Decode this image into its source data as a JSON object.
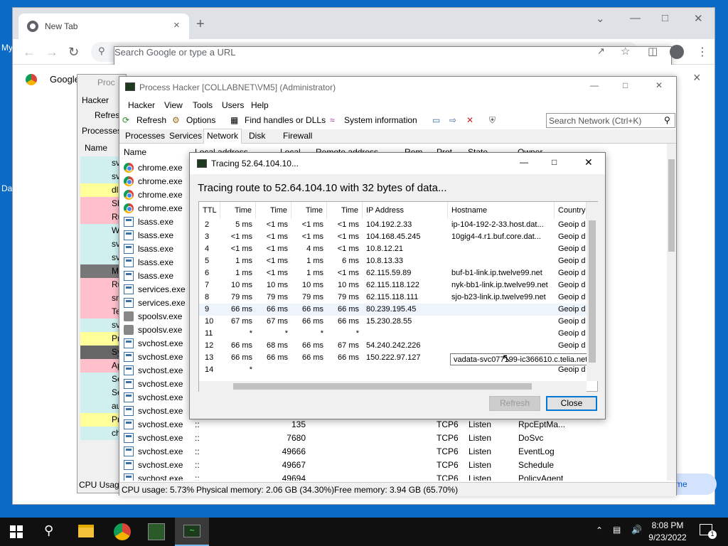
{
  "desktop": {
    "left_label": "My",
    "left_label2": "Da"
  },
  "browser": {
    "tab_title": "New Tab",
    "tab_close": "×",
    "new_tab": "+",
    "omnibox_placeholder": "Search Google or type a URL",
    "bookmark_google": "Google",
    "bookmark_close": "×",
    "corner_text": "me"
  },
  "ph_back": {
    "title": "Proc",
    "menu": "Hacker",
    "refresh": "Refres",
    "processes": "Processes",
    "name": "Name",
    "cpu": "CPU Usage",
    "rows": [
      "sv",
      "sv",
      "dll",
      "Sh",
      "Ru",
      "W",
      "sv",
      "sv",
      "M",
      "Ru",
      "sm",
      "Te",
      "sv",
      "Pr",
      "Sy",
      "Ap",
      "Se",
      "Se",
      "au",
      "Pr",
      "ch"
    ]
  },
  "ph": {
    "title": "Process Hacker [COLLABNET\\VM5] (Administrator)",
    "menu": [
      "Hacker",
      "View",
      "Tools",
      "Users",
      "Help"
    ],
    "toolbar": {
      "refresh": "Refresh",
      "options": "Options",
      "find": "Find handles or DLLs",
      "sysinfo": "System information"
    },
    "search_placeholder": "Search Network (Ctrl+K)",
    "tabs": [
      "Processes",
      "Services",
      "Network",
      "Disk",
      "Firewall"
    ],
    "columns": {
      "name": "Name",
      "local_address": "Local address",
      "local": "Local",
      "remote_address": "Remote address",
      "rem": "Rem",
      "prot": "Prot",
      "state": "State",
      "owner": "Owner"
    },
    "rows": [
      {
        "name": "chrome.exe",
        "icon": "chrome"
      },
      {
        "name": "chrome.exe",
        "icon": "chrome"
      },
      {
        "name": "chrome.exe",
        "icon": "chrome"
      },
      {
        "name": "chrome.exe",
        "icon": "chrome"
      },
      {
        "name": "lsass.exe",
        "icon": "exe"
      },
      {
        "name": "lsass.exe",
        "icon": "exe"
      },
      {
        "name": "lsass.exe",
        "icon": "exe"
      },
      {
        "name": "lsass.exe",
        "icon": "exe"
      },
      {
        "name": "lsass.exe",
        "icon": "exe"
      },
      {
        "name": "services.exe",
        "icon": "exe"
      },
      {
        "name": "services.exe",
        "icon": "exe"
      },
      {
        "name": "spoolsv.exe",
        "icon": "print"
      },
      {
        "name": "spoolsv.exe",
        "icon": "print"
      },
      {
        "name": "svchost.exe",
        "icon": "exe"
      },
      {
        "name": "svchost.exe",
        "icon": "exe"
      },
      {
        "name": "svchost.exe",
        "icon": "exe"
      },
      {
        "name": "svchost.exe",
        "icon": "exe"
      },
      {
        "name": "svchost.exe",
        "icon": "exe"
      },
      {
        "name": "svchost.exe",
        "icon": "exe"
      },
      {
        "name": "svchost.exe",
        "icon": "exe",
        "local": "::",
        "port": "135",
        "prot": "TCP6",
        "state": "Listen",
        "owner": "RpcEptMa..."
      },
      {
        "name": "svchost.exe",
        "icon": "exe",
        "local": "::",
        "port": "7680",
        "prot": "TCP6",
        "state": "Listen",
        "owner": "DoSvc"
      },
      {
        "name": "svchost.exe",
        "icon": "exe",
        "local": "::",
        "port": "49666",
        "prot": "TCP6",
        "state": "Listen",
        "owner": "EventLog"
      },
      {
        "name": "svchost.exe",
        "icon": "exe",
        "local": "::",
        "port": "49667",
        "prot": "TCP6",
        "state": "Listen",
        "owner": "Schedule"
      },
      {
        "name": "svchost.exe",
        "icon": "exe",
        "local": "::",
        "port": "49694",
        "prot": "TCP6",
        "state": "Listen",
        "owner": "PolicyAgent"
      }
    ],
    "status": {
      "cpu": "CPU usage: 5.73%",
      "physical": "Physical memory: 2.06 GB (34.30%)",
      "free": "Free memory: 3.94 GB (65.70%)"
    }
  },
  "dialog": {
    "title": "Tracing 52.64.104.10...",
    "header": "Tracing route to 52.64.104.10 with 32 bytes of data...",
    "columns": [
      "TTL",
      "Time",
      "Time",
      "Time",
      "Time",
      "IP Address",
      "Hostname",
      "Country"
    ],
    "rows": [
      [
        "2",
        "5 ms",
        "<1 ms",
        "<1 ms",
        "<1 ms",
        "104.192.2.33",
        "ip-104-192-2-33.host.dat...",
        "Geoip d"
      ],
      [
        "3",
        "<1 ms",
        "<1 ms",
        "<1 ms",
        "<1 ms",
        "104.168.45.245",
        "10gig4-4.r1.buf.core.dat...",
        "Geoip d"
      ],
      [
        "4",
        "<1 ms",
        "<1 ms",
        "4 ms",
        "<1 ms",
        "10.8.12.21",
        "",
        "Geoip d"
      ],
      [
        "5",
        "1 ms",
        "<1 ms",
        "1 ms",
        "6 ms",
        "10.8.13.33",
        "",
        "Geoip d"
      ],
      [
        "6",
        "1 ms",
        "<1 ms",
        "1 ms",
        "<1 ms",
        "62.115.59.89",
        "buf-b1-link.ip.twelve99.net",
        "Geoip d"
      ],
      [
        "7",
        "10 ms",
        "10 ms",
        "10 ms",
        "10 ms",
        "62.115.118.122",
        "nyk-bb1-link.ip.twelve99.net",
        "Geoip d"
      ],
      [
        "8",
        "79 ms",
        "79 ms",
        "79 ms",
        "79 ms",
        "62.115.118.111",
        "sjo-b23-link.ip.twelve99.net",
        "Geoip d"
      ],
      [
        "9",
        "66 ms",
        "66 ms",
        "66 ms",
        "66 ms",
        "80.239.195.45",
        "",
        "Geoip d"
      ],
      [
        "10",
        "67 ms",
        "67 ms",
        "66 ms",
        "66 ms",
        "15.230.28.55",
        "",
        "Geoip d"
      ],
      [
        "11",
        "*",
        "*",
        "*",
        "*",
        "",
        "",
        "Geoip d"
      ],
      [
        "12",
        "66 ms",
        "68 ms",
        "66 ms",
        "67 ms",
        "54.240.242.226",
        "",
        "Geoip d"
      ],
      [
        "13",
        "66 ms",
        "66 ms",
        "66 ms",
        "66 ms",
        "150.222.97.127",
        "",
        "Geoip d"
      ],
      [
        "14",
        "*",
        "",
        "",
        "",
        "",
        "",
        "Geoip d"
      ]
    ],
    "tooltip": "vadata-svc077199-ic366610.c.telia.net",
    "refresh_button": "Refresh",
    "close_button": "Close"
  },
  "taskbar": {
    "time": "8:08 PM",
    "date": "9/23/2022",
    "notif_count": "1"
  },
  "colors": {
    "desktop": "#0b6ac6",
    "taskbar": "#101010",
    "accent": "#0078d7"
  }
}
